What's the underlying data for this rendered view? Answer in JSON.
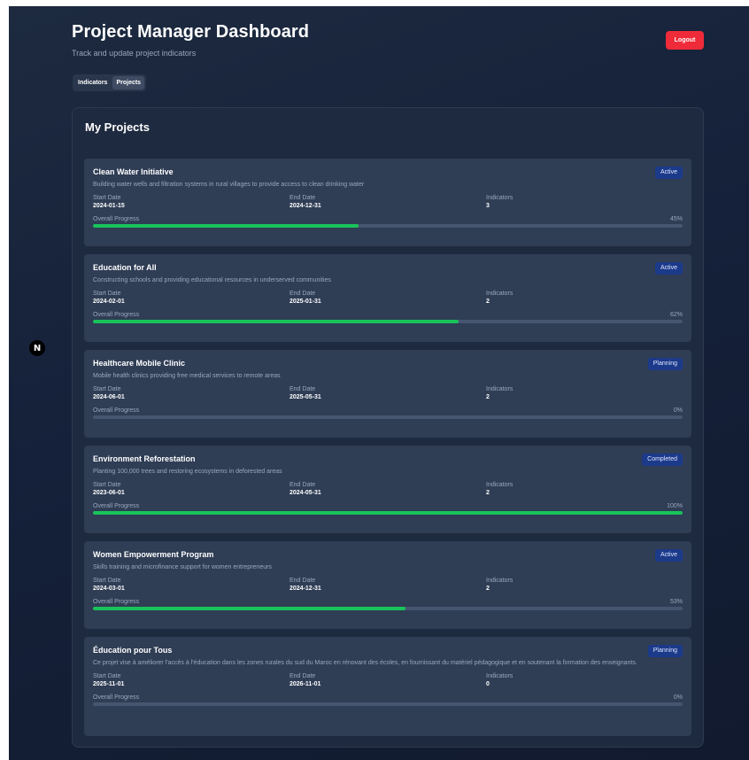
{
  "header": {
    "title": "Project Manager Dashboard",
    "subtitle": "Track and update project indicators",
    "logout_label": "Logout"
  },
  "tabs": [
    {
      "label": "Indicators",
      "active": false
    },
    {
      "label": "Projects",
      "active": true
    }
  ],
  "panel": {
    "title": "My Projects",
    "labels": {
      "start": "Start Date",
      "end": "End Date",
      "indicators": "Indicators",
      "progress": "Overall Progress"
    }
  },
  "projects": [
    {
      "name": "Clean Water Initiative",
      "description": "Building water wells and filtration systems in rural villages to provide access to clean drinking water",
      "status": "Active",
      "start": "2024-01-15",
      "end": "2024-12-31",
      "indicators": "3",
      "progress_label": "45%",
      "progress": 45
    },
    {
      "name": "Education for All",
      "description": "Constructing schools and providing educational resources in underserved communities",
      "status": "Active",
      "start": "2024-02-01",
      "end": "2025-01-31",
      "indicators": "2",
      "progress_label": "62%",
      "progress": 62
    },
    {
      "name": "Healthcare Mobile Clinic",
      "description": "Mobile health clinics providing free medical services to remote areas",
      "status": "Planning",
      "start": "2024-06-01",
      "end": "2025-05-31",
      "indicators": "2",
      "progress_label": "0%",
      "progress": 0
    },
    {
      "name": "Environment Reforestation",
      "description": "Planting 100,000 trees and restoring ecosystems in deforested areas",
      "status": "Completed",
      "start": "2023-06-01",
      "end": "2024-05-31",
      "indicators": "2",
      "progress_label": "100%",
      "progress": 100
    },
    {
      "name": "Women Empowerment Program",
      "description": "Skills training and microfinance support for women entrepreneurs",
      "status": "Active",
      "start": "2024-03-01",
      "end": "2024-12-31",
      "indicators": "2",
      "progress_label": "53%",
      "progress": 53
    },
    {
      "name": "Éducation pour Tous",
      "description": "Ce projet vise à améliorer l'accès à l'éducation dans les zones rurales du sud du Maroc en rénovant des écoles, en fournissant du matériel pédagogique et en soutenant la formation des enseignants.",
      "status": "Planning",
      "start": "2025-11-01",
      "end": "2026-11-01",
      "indicators": "0",
      "progress_label": "0%",
      "progress": 0
    }
  ],
  "colors": {
    "accent_progress": "#18c45a",
    "logout": "#ef2b39",
    "status_badge": "#1c3a8a"
  },
  "icons": {
    "framework_badge": "next-logo-icon"
  }
}
